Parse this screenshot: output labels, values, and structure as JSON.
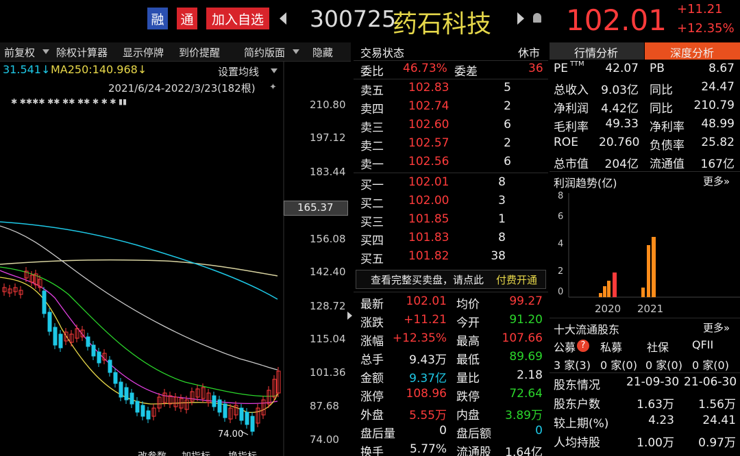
{
  "header": {
    "rong": "融",
    "tong": "通",
    "add_watch": "加入自选",
    "code": "300725",
    "name": "药石科技",
    "price": "102.01",
    "change": "+11.21",
    "change_pct": "+12.35%"
  },
  "toolbar": {
    "items": [
      "前复权",
      "除权计算器",
      "显示停牌",
      "到价提醒",
      "简约版面",
      "隐藏"
    ]
  },
  "chart": {
    "ma_left": "31.541↓",
    "ma250": "MA250:140.968↓",
    "ma_setting": "设置均线",
    "range": "2021/6/24-2022/3/23(182根)",
    "yticks": [
      "210.80",
      "197.12",
      "183.44",
      "165.37",
      "156.08",
      "142.40",
      "128.72",
      "115.04",
      "101.36",
      "87.68",
      "74.00"
    ],
    "low_label": "74.00",
    "bottom_tabs": [
      "改参数",
      "加指标",
      "换指标"
    ]
  },
  "order": {
    "status_label": "交易状态",
    "status": "休市",
    "weibi_label": "委比",
    "weibi": "46.73%",
    "weicha_label": "委差",
    "weicha": "36",
    "sell": [
      {
        "label": "卖五",
        "price": "102.83",
        "vol": "5"
      },
      {
        "label": "卖四",
        "price": "102.74",
        "vol": "2"
      },
      {
        "label": "卖三",
        "price": "102.60",
        "vol": "6"
      },
      {
        "label": "卖二",
        "price": "102.57",
        "vol": "2"
      },
      {
        "label": "卖一",
        "price": "102.56",
        "vol": "6"
      }
    ],
    "buy": [
      {
        "label": "买一",
        "price": "102.01",
        "vol": "8"
      },
      {
        "label": "买二",
        "price": "102.00",
        "vol": "3"
      },
      {
        "label": "买三",
        "price": "101.85",
        "vol": "1"
      },
      {
        "label": "买四",
        "price": "101.83",
        "vol": "8"
      },
      {
        "label": "买五",
        "price": "101.82",
        "vol": "38"
      }
    ],
    "notice": "查看完整买卖盘，请点此",
    "notice_link": "付费开通"
  },
  "quote": [
    {
      "l1": "最新",
      "v1": "102.01",
      "l2": "均价",
      "v2": "99.27",
      "c1": "red",
      "c2": "red"
    },
    {
      "l1": "涨跌",
      "v1": "+11.21",
      "l2": "今开",
      "v2": "91.20",
      "c1": "red",
      "c2": "green"
    },
    {
      "l1": "涨幅",
      "v1": "+12.35%",
      "l2": "最高",
      "v2": "107.66",
      "c1": "red",
      "c2": "red"
    },
    {
      "l1": "总手",
      "v1": "9.43万",
      "l2": "最低",
      "v2": "89.69",
      "c1": "white",
      "c2": "green"
    },
    {
      "l1": "金额",
      "v1": "9.37亿",
      "l2": "量比",
      "v2": "2.18",
      "c1": "cyan",
      "c2": "white"
    },
    {
      "l1": "涨停",
      "v1": "108.96",
      "l2": "跌停",
      "v2": "72.64",
      "c1": "red",
      "c2": "green"
    },
    {
      "l1": "外盘",
      "v1": "5.55万",
      "l2": "内盘",
      "v2": "3.89万",
      "c1": "red",
      "c2": "green"
    },
    {
      "l1": "盘后量",
      "v1": "0",
      "l2": "盘后额",
      "v2": "0",
      "c1": "white",
      "c2": "cyan"
    },
    {
      "l1": "换手",
      "v1": "5.77%",
      "l2": "流通股",
      "v2": "1.64亿",
      "c1": "white",
      "c2": "white"
    }
  ],
  "analysis": {
    "tab1": "行情分析",
    "tab2": "深度分析",
    "rows": [
      [
        "PE",
        "42.07",
        "PB",
        "8.67"
      ],
      [
        "总收入",
        "9.03亿",
        "同比",
        "24.47"
      ],
      [
        "净利润",
        "4.42亿",
        "同比",
        "210.79"
      ],
      [
        "毛利率",
        "49.33",
        "净利率",
        "48.99"
      ],
      [
        "ROE",
        "20.760",
        "负债率",
        "25.82"
      ],
      [
        "总市值",
        "204亿",
        "流通值",
        "167亿"
      ]
    ],
    "pe_sup": "TTM",
    "profit_title": "利润趋势(亿)",
    "more": "更多»",
    "profit_yticks": [
      "8",
      "6",
      "4",
      "2",
      "0"
    ],
    "years": [
      "2020",
      "2021"
    ],
    "holders_title": "十大流通股东",
    "holder_types": [
      "公募",
      "私募",
      "社保",
      "QFII"
    ],
    "q_mark": "?",
    "holder_counts": [
      "3 家(3)",
      "0 家(0)",
      "0 家(0)",
      "0 家(0)"
    ],
    "sh": [
      [
        "股东情况",
        "21-09-30",
        "21-06-30"
      ],
      [
        "股东户数",
        "1.63万",
        "1.56万"
      ],
      [
        "较上期(%)",
        "4.23",
        "24.41"
      ],
      [
        "人均持股",
        "1.00万",
        "0.97万"
      ]
    ]
  },
  "colors": {
    "up": "#ff3b3b",
    "down": "#2bd62b",
    "accent": "#e8501e"
  }
}
